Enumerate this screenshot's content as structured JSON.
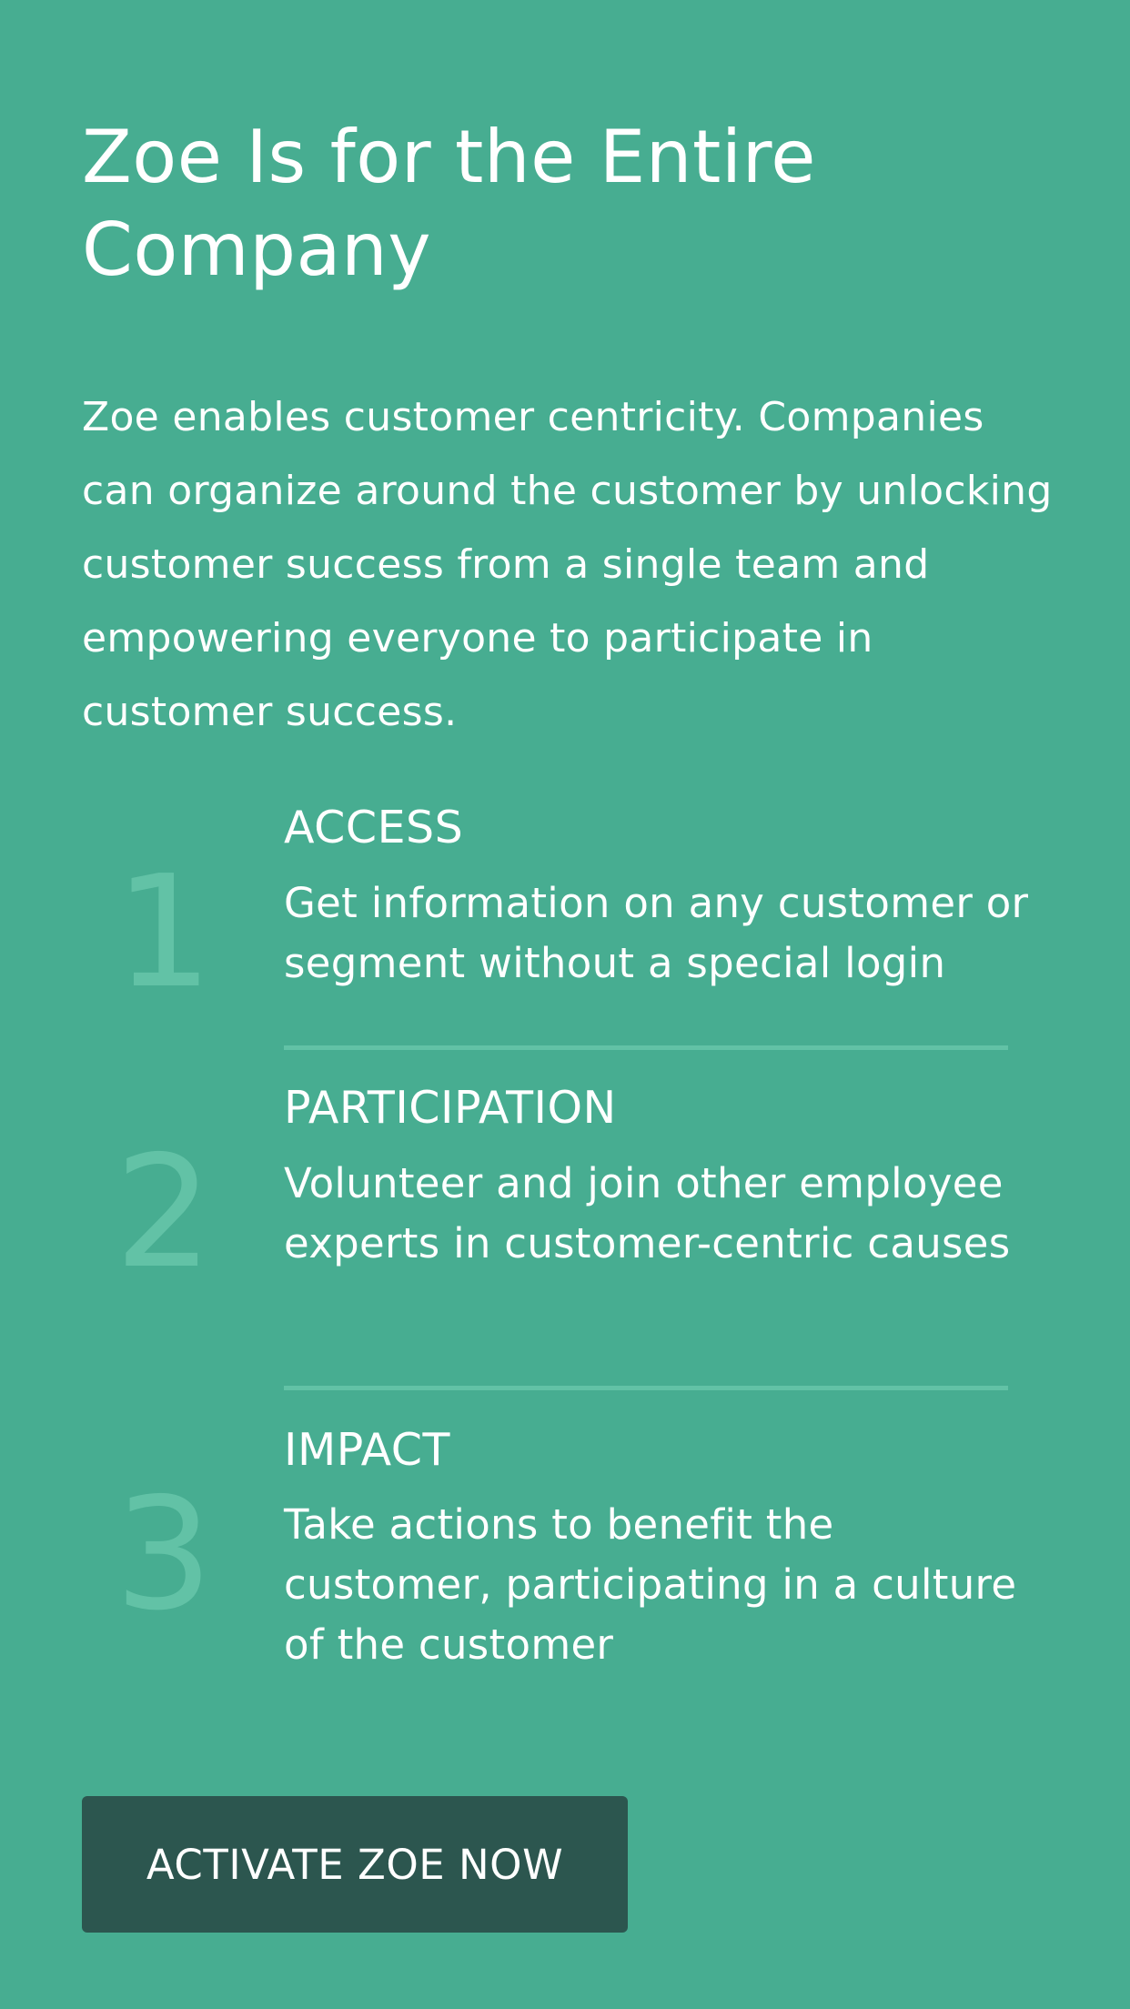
{
  "colors": {
    "background": "#47ad91",
    "text": "#ffffff",
    "step_number": "#62c2a6",
    "divider": "#62c2a6",
    "button_background": "#2c564f"
  },
  "header": {
    "title": "Zoe Is for the Entire Company"
  },
  "intro": {
    "text": "Zoe enables customer centricity. Companies can organize around the customer by unlocking customer success from a single team and empowering everyone to participate in customer success."
  },
  "steps": [
    {
      "number": "1",
      "heading": "ACCESS",
      "text": "Get information on any customer or segment without a special login"
    },
    {
      "number": "2",
      "heading": "PARTICIPATION",
      "text": "Volunteer and join other employee experts in customer-centric causes"
    },
    {
      "number": "3",
      "heading": "IMPACT",
      "text": "Take actions to benefit the customer, participating in a culture of the customer"
    }
  ],
  "cta": {
    "label": "ACTIVATE ZOE NOW"
  }
}
